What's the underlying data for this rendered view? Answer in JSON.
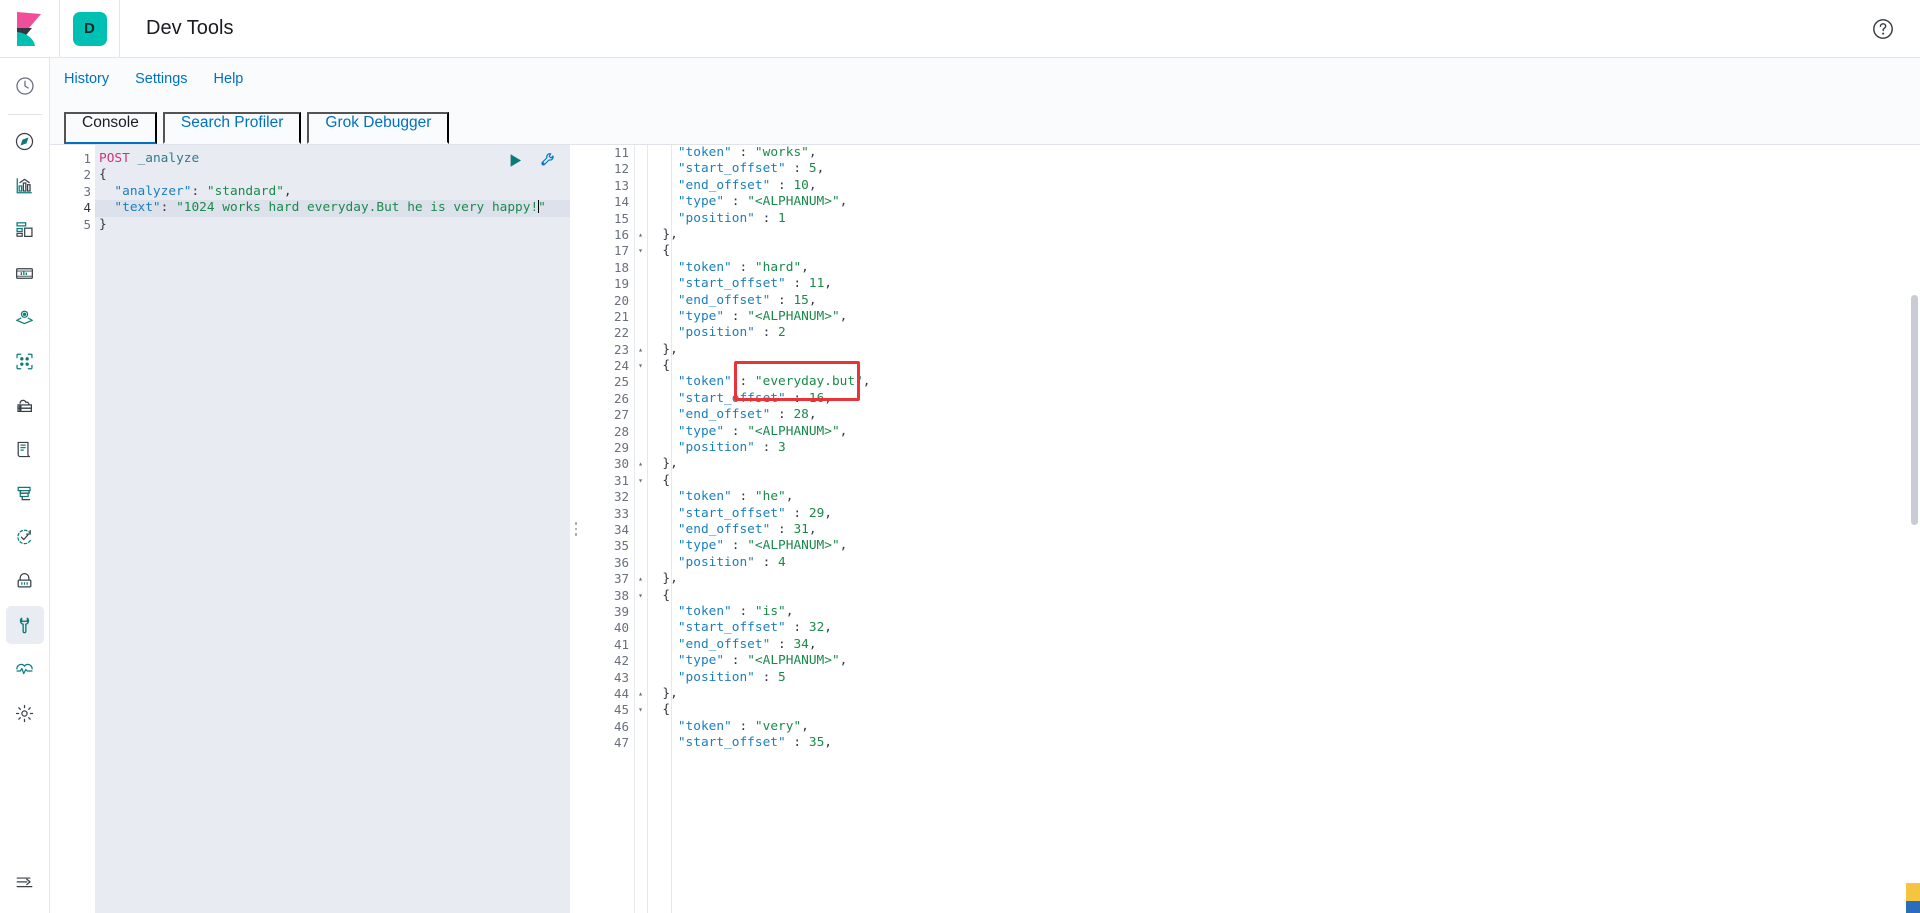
{
  "header": {
    "app_badge": "D",
    "title": "Dev Tools",
    "logo_name": "kibana-logo",
    "right_icon": "help-circle-icon"
  },
  "rail": {
    "items": [
      {
        "name": "recently-viewed",
        "icon": "clock-icon"
      },
      {
        "name": "discover",
        "icon": "compass-icon"
      },
      {
        "name": "visualize",
        "icon": "bar-chart-icon"
      },
      {
        "name": "dashboard",
        "icon": "dashboard-grid-icon"
      },
      {
        "name": "canvas",
        "icon": "presentation-icon"
      },
      {
        "name": "maps",
        "icon": "map-pin-layers-icon"
      },
      {
        "name": "machine-learning",
        "icon": "ml-nodes-icon"
      },
      {
        "name": "infrastructure",
        "icon": "cloud-server-icon"
      },
      {
        "name": "logs",
        "icon": "logs-document-icon"
      },
      {
        "name": "apm",
        "icon": "apm-trace-icon"
      },
      {
        "name": "uptime",
        "icon": "uptime-check-icon"
      },
      {
        "name": "siem",
        "icon": "security-lock-icon"
      },
      {
        "name": "dev-tools",
        "icon": "wrench-icon",
        "selected": true
      },
      {
        "name": "monitoring",
        "icon": "heartbeat-icon"
      },
      {
        "name": "management",
        "icon": "gear-icon"
      }
    ],
    "collapse": {
      "name": "collapse-nav",
      "icon": "collapse-arrow-icon"
    }
  },
  "topnav": {
    "items": [
      {
        "label": "History"
      },
      {
        "label": "Settings"
      },
      {
        "label": "Help"
      }
    ]
  },
  "tabs": [
    {
      "label": "Console",
      "active": true
    },
    {
      "label": "Search Profiler",
      "active": false
    },
    {
      "label": "Grok Debugger",
      "active": false
    }
  ],
  "editor": {
    "actions": [
      {
        "name": "send-request-button",
        "icon": "play-triangle-icon"
      },
      {
        "name": "auto-indent-button",
        "icon": "wrench-icon"
      }
    ],
    "lines": [
      {
        "n": "1",
        "fold": "",
        "highlight": false,
        "segments": [
          {
            "cls": "tok-method",
            "t": "POST"
          },
          {
            "cls": "tok-punc",
            "t": " "
          },
          {
            "cls": "tok-path",
            "t": "_analyze"
          }
        ]
      },
      {
        "n": "2",
        "fold": "▾",
        "highlight": false,
        "segments": [
          {
            "cls": "tok-brace",
            "t": "{"
          }
        ]
      },
      {
        "n": "3",
        "fold": "",
        "highlight": false,
        "segments": [
          {
            "cls": "tok-key",
            "t": "  \"analyzer\""
          },
          {
            "cls": "tok-punc",
            "t": ": "
          },
          {
            "cls": "tok-str",
            "t": "\"standard\""
          },
          {
            "cls": "tok-punc",
            "t": ","
          }
        ]
      },
      {
        "n": "4",
        "fold": "",
        "highlight": true,
        "segments": [
          {
            "cls": "tok-key",
            "t": "  \"text\""
          },
          {
            "cls": "tok-punc",
            "t": ": "
          },
          {
            "cls": "tok-str",
            "t": "\"1024 works hard everyday.But he is very happy!"
          },
          {
            "cls": "caret",
            "t": ""
          },
          {
            "cls": "tok-str",
            "t": "\""
          }
        ]
      },
      {
        "n": "5",
        "fold": "▴",
        "highlight": false,
        "segments": [
          {
            "cls": "tok-brace",
            "t": "}"
          }
        ]
      }
    ]
  },
  "response": {
    "lines": [
      {
        "n": "11",
        "fold": "",
        "text": "    \"token\" : \"works\","
      },
      {
        "n": "12",
        "fold": "",
        "text": "    \"start_offset\" : 5,"
      },
      {
        "n": "13",
        "fold": "",
        "text": "    \"end_offset\" : 10,"
      },
      {
        "n": "14",
        "fold": "",
        "text": "    \"type\" : \"<ALPHANUM>\","
      },
      {
        "n": "15",
        "fold": "",
        "text": "    \"position\" : 1"
      },
      {
        "n": "16",
        "fold": "▴",
        "text": "  },"
      },
      {
        "n": "17",
        "fold": "▾",
        "text": "  {"
      },
      {
        "n": "18",
        "fold": "",
        "text": "    \"token\" : \"hard\","
      },
      {
        "n": "19",
        "fold": "",
        "text": "    \"start_offset\" : 11,"
      },
      {
        "n": "20",
        "fold": "",
        "text": "    \"end_offset\" : 15,"
      },
      {
        "n": "21",
        "fold": "",
        "text": "    \"type\" : \"<ALPHANUM>\","
      },
      {
        "n": "22",
        "fold": "",
        "text": "    \"position\" : 2"
      },
      {
        "n": "23",
        "fold": "▴",
        "text": "  },"
      },
      {
        "n": "24",
        "fold": "▾",
        "text": "  {"
      },
      {
        "n": "25",
        "fold": "",
        "text": "    \"token\" : \"everyday.but\","
      },
      {
        "n": "26",
        "fold": "",
        "text": "    \"start_offset\" : 16,"
      },
      {
        "n": "27",
        "fold": "",
        "text": "    \"end_offset\" : 28,"
      },
      {
        "n": "28",
        "fold": "",
        "text": "    \"type\" : \"<ALPHANUM>\","
      },
      {
        "n": "29",
        "fold": "",
        "text": "    \"position\" : 3"
      },
      {
        "n": "30",
        "fold": "▴",
        "text": "  },"
      },
      {
        "n": "31",
        "fold": "▾",
        "text": "  {"
      },
      {
        "n": "32",
        "fold": "",
        "text": "    \"token\" : \"he\","
      },
      {
        "n": "33",
        "fold": "",
        "text": "    \"start_offset\" : 29,"
      },
      {
        "n": "34",
        "fold": "",
        "text": "    \"end_offset\" : 31,"
      },
      {
        "n": "35",
        "fold": "",
        "text": "    \"type\" : \"<ALPHANUM>\","
      },
      {
        "n": "36",
        "fold": "",
        "text": "    \"position\" : 4"
      },
      {
        "n": "37",
        "fold": "▴",
        "text": "  },"
      },
      {
        "n": "38",
        "fold": "▾",
        "text": "  {"
      },
      {
        "n": "39",
        "fold": "",
        "text": "    \"token\" : \"is\","
      },
      {
        "n": "40",
        "fold": "",
        "text": "    \"start_offset\" : 32,"
      },
      {
        "n": "41",
        "fold": "",
        "text": "    \"end_offset\" : 34,"
      },
      {
        "n": "42",
        "fold": "",
        "text": "    \"type\" : \"<ALPHANUM>\","
      },
      {
        "n": "43",
        "fold": "",
        "text": "    \"position\" : 5"
      },
      {
        "n": "44",
        "fold": "▴",
        "text": "  },"
      },
      {
        "n": "45",
        "fold": "▾",
        "text": "  {"
      },
      {
        "n": "46",
        "fold": "",
        "text": "    \"token\" : \"very\","
      },
      {
        "n": "47",
        "fold": "",
        "text": "    \"start_offset\" : 35,"
      }
    ]
  },
  "annotation": {
    "highlight_token": "\"everyday.but\"",
    "color": "#e8333a"
  },
  "colors": {
    "accent": "#0071c2",
    "brand_teal": "#00bfb3",
    "brand_pink": "#f04e98",
    "string_green": "#1a8a4a",
    "key_blue": "#1a7fbd",
    "method_pink": "#c9377a"
  }
}
